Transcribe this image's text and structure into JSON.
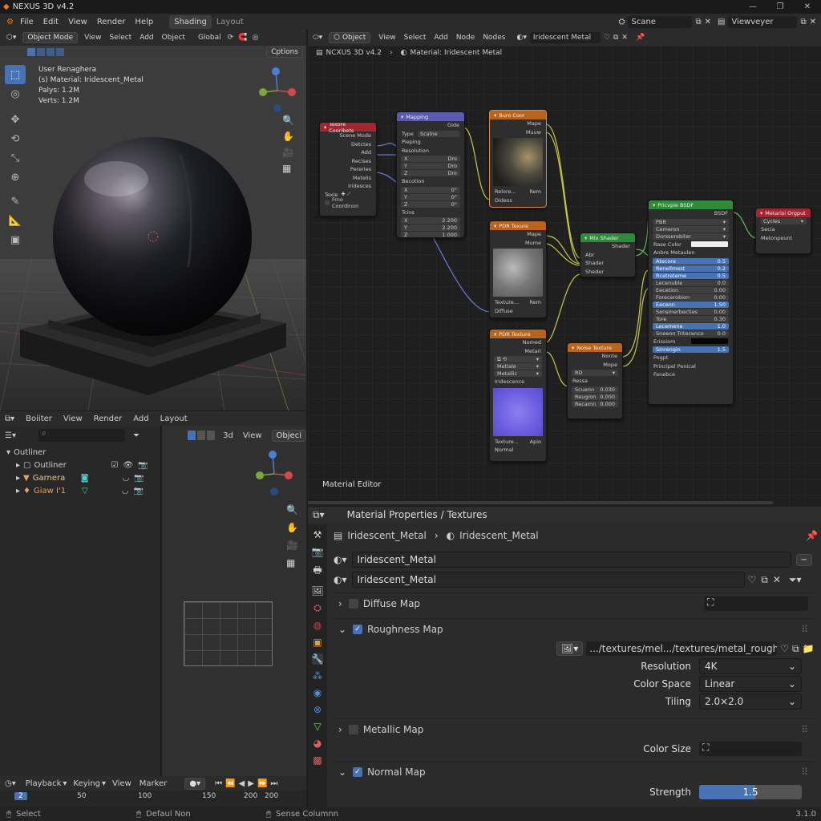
{
  "app": {
    "title": "NEXUS 3D v4.2"
  },
  "topmenu": {
    "file": "File",
    "edit": "Edit",
    "view": "View",
    "render": "Render",
    "help": "Help"
  },
  "workspaces": {
    "shading": "Shading",
    "layout": "Layout"
  },
  "scene": {
    "value": "Scane",
    "view_layer": "Viewveyer"
  },
  "viewport": {
    "mode": "Object Mode",
    "view": "View",
    "select": "Select",
    "add": "Add",
    "object": "Object",
    "transform": "Global",
    "options": "Cptions",
    "info_line1": "User Renaghera",
    "info_line2": "(s) Material: Iridescent_Metal",
    "polys": "Palys:  1.2M",
    "verts": "Verts:  1.2M"
  },
  "outliner": {
    "menu": {
      "editor": "Boiiter",
      "view": "View",
      "render": "Render",
      "add": "Add",
      "layout": "Layout"
    },
    "root": "Outliner",
    "items": [
      {
        "label": "Outliner"
      },
      {
        "label": "Garnera"
      },
      {
        "label": "Giaw I'1"
      }
    ]
  },
  "viewport2": {
    "mode3d": "3d",
    "view": "View",
    "object": "Objeci"
  },
  "timeline": {
    "playback": "Playback",
    "keying": "Keying",
    "view": "View",
    "marker": "Marker",
    "current": "2",
    "ticks": [
      "50",
      "100",
      "150",
      "200",
      "200"
    ]
  },
  "node_editor": {
    "object": "Object",
    "view": "View",
    "select": "Select",
    "add": "Add",
    "node": "Node",
    "nodes": "Nodes",
    "material": "Iridescent Metal",
    "breadcrumb_app": "NCXUS 3D v4.2",
    "breadcrumb_mat": "Material: Iridescent Metal",
    "label": "Material Editor"
  },
  "nodes": {
    "texcoord": {
      "title": "Texore Cooribets",
      "outputs": [
        "Scene Mode",
        "Detctes",
        "Add",
        "Recises",
        "Pereries",
        "Metelis",
        "Iridesces"
      ],
      "extra": "Texie",
      "footer": "Frno Coordinon"
    },
    "mapping": {
      "title": "Mapping",
      "out": "Gide",
      "type_label": "Type",
      "type": "Scalne",
      "rows": [
        "Pieping",
        "Resolution"
      ],
      "loc": [
        "Dro",
        "Dro",
        "Dro"
      ],
      "rot_label": "Becotion",
      "rot": [
        "0°",
        "0°",
        "0°"
      ],
      "scale_label": "Tcins",
      "scale": [
        "2.200",
        "2.200",
        "1.000"
      ]
    },
    "basecolor": {
      "title": "Buro Coor",
      "outs": [
        "Mape",
        "Muuw"
      ],
      "foot": "Relore...",
      "foot2": "Rem",
      "foot3": "Didess"
    },
    "pbr1": {
      "title": "PDR Texure",
      "outs": [
        "Mape",
        "Mume"
      ],
      "foot": "Texture...",
      "foot2": "Rem",
      "foot3": "Diffuse"
    },
    "pbr2": {
      "title": "PDR Texture",
      "outs": [
        "Nomed",
        "Metari"
      ],
      "sel1": "Metlale",
      "sel2": "Metallic",
      "lbl": "Iridescence",
      "foot": "Texture...",
      "foot2": "Apio",
      "foot3": "Normal"
    },
    "mix": {
      "title": "Mix Shader",
      "out": "Shader",
      "ins": [
        "Abr",
        "Shader",
        "Sheder"
      ]
    },
    "noise": {
      "title": "Noise Texture",
      "outs": [
        "Nonte",
        "Mope"
      ],
      "sel": "RD",
      "in": "Ressa",
      "fields": [
        {
          "k": "Scuenn",
          "v": "0.030"
        },
        {
          "k": "Reugion",
          "v": "0.000"
        },
        {
          "k": "Recamn",
          "v": "0.000"
        }
      ]
    },
    "bsdf": {
      "title": "Pricvpie BSDF",
      "out": "BSDF",
      "sel1": "PBR",
      "sel2": "Cemeron",
      "sel3": "Dorsserebiter",
      "color_label": "Rase Color",
      "subtitle": "Anbre Metaulen",
      "fields": [
        {
          "k": "Atecore",
          "v": "0.5",
          "b": true
        },
        {
          "k": "Renellmest",
          "v": "0.2",
          "b": true
        },
        {
          "k": "Rcetreteme",
          "v": "0.5",
          "b": true
        },
        {
          "k": "Lecenuble",
          "v": "0.0",
          "b": false
        },
        {
          "k": "Eecetion",
          "v": "0.00",
          "b": false
        },
        {
          "k": "Forecerobion",
          "v": "0.00",
          "b": false
        },
        {
          "k": "Eecenn",
          "v": "1.50",
          "b": true
        },
        {
          "k": "Sensmerbecties",
          "v": "0.00",
          "b": false
        },
        {
          "k": "Tore",
          "v": "0.30",
          "b": false
        },
        {
          "k": "Lecemene",
          "v": "1.0",
          "b": true
        },
        {
          "k": "Sneeon Tritecence",
          "v": "0.0",
          "b": false
        }
      ],
      "em_label": "Erissiom",
      "strength_label": "Sinrengin",
      "strength": "1.5",
      "tail": [
        "Pogpt",
        "Principel Penical",
        "Fanebce"
      ]
    },
    "output": {
      "title": "Metarisi Orgput",
      "sel": "Cycles",
      "ins": [
        "Secia",
        "Metonpeunt"
      ]
    }
  },
  "props": {
    "title": "Material Properties / Textures",
    "breadcrumb": [
      "Iridescent_Metal",
      "Iridescent_Metal"
    ],
    "slot": "Iridescent_Metal",
    "material": "Iridescent_Metal",
    "diffuse": "Diffuse Map",
    "roughness": "Roughness Map",
    "path": ".../textures/mel.../textures/metal_rough.png",
    "resolution_label": "Resolution",
    "resolution": "4K",
    "colorspace_label": "Color Space",
    "colorspace": "Linear",
    "tiling_label": "Tiling",
    "tiling": "2.0×2.0",
    "metallic": "Metallic Map",
    "colorsize_label": "Color Size",
    "normal": "Normal Map",
    "strength_label": "Strength",
    "strength": "1.5",
    "strength_frac": 0.55
  },
  "status": {
    "select": "Select",
    "mode": "Defaul Non",
    "hint": "Sense Columnn",
    "version": "3.1.0"
  }
}
